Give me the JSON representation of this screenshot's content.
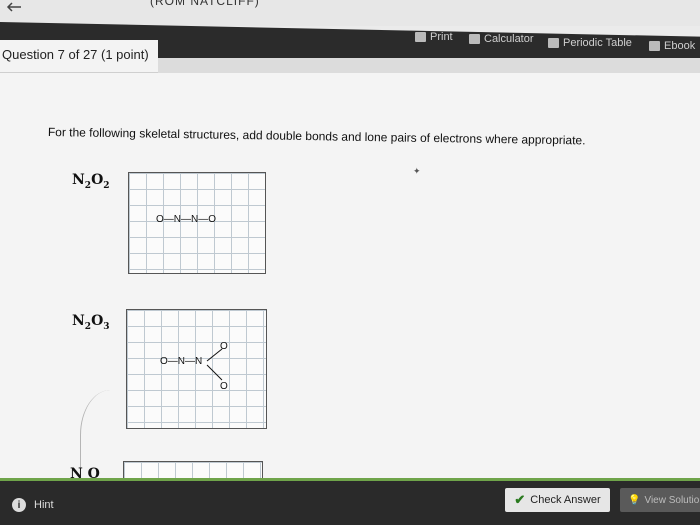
{
  "window": {
    "title_fragment": "(ROM NATCLIFF)"
  },
  "toolbar": {
    "print_label": "Print",
    "calculator_label": "Calculator",
    "periodic_table_label": "Periodic Table",
    "ebook_label": "Ebook"
  },
  "question": {
    "header": "Question 7 of 27 (1 point)",
    "instructions": "For the following skeletal structures, add double bonds and lone pairs of electrons where appropriate."
  },
  "structures": [
    {
      "formula_el1": "N",
      "formula_sub1": "2",
      "formula_el2": "O",
      "formula_sub2": "2",
      "skeleton": "O—N—N—O"
    },
    {
      "formula_el1": "N",
      "formula_sub1": "2",
      "formula_el2": "O",
      "formula_sub2": "3",
      "skeleton_main": "O—N—N",
      "skeleton_branch_atom": "O"
    },
    {
      "formula_partial": "N O"
    }
  ],
  "footer": {
    "hint_label": "Hint",
    "hint_icon": "info-icon",
    "check_answer_label": "Check Answer",
    "view_solution_label": "View Solutio"
  },
  "colors": {
    "toolbar_bg": "#2b2b2b",
    "accent_green": "#6fa44a",
    "check_mark": "#2a7a1f"
  }
}
